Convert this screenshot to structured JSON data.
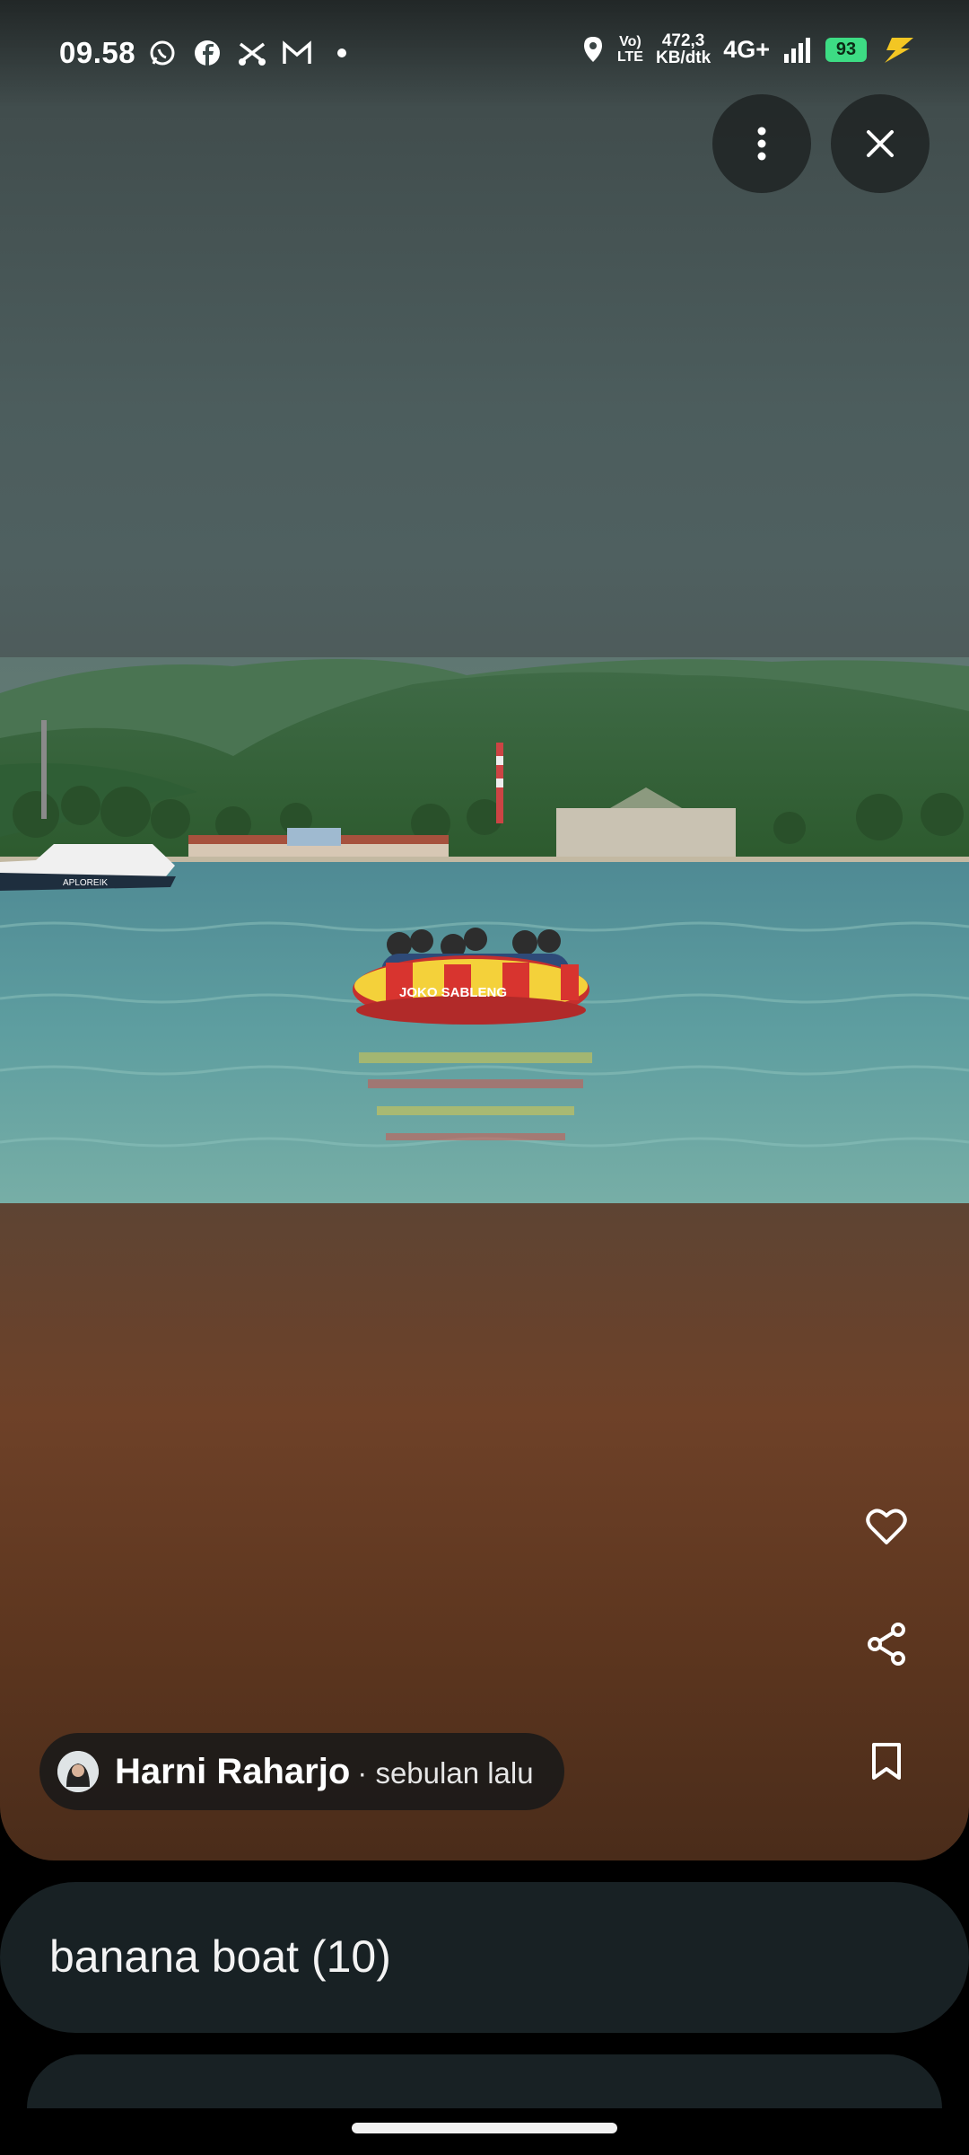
{
  "status_bar": {
    "time": "09.58",
    "left_icons": [
      "whatsapp-icon",
      "facebook-icon",
      "app-icon",
      "gmail-icon",
      "dot-icon"
    ],
    "volte_line1": "Vo)",
    "volte_line2": "LTE",
    "speed_value": "472,3",
    "speed_unit": "KB/dtk",
    "network": "4G+",
    "battery": "93"
  },
  "viewer": {
    "author_name": "Harni Raharjo",
    "author_time": "· sebulan lalu",
    "boat_text": "JOKO SABLENG",
    "yacht_text": "APLOREIK"
  },
  "album": {
    "label": "banana boat (10)"
  },
  "colors": {
    "background": "#000000",
    "card": "#182124",
    "battery": "#3ddc84"
  }
}
